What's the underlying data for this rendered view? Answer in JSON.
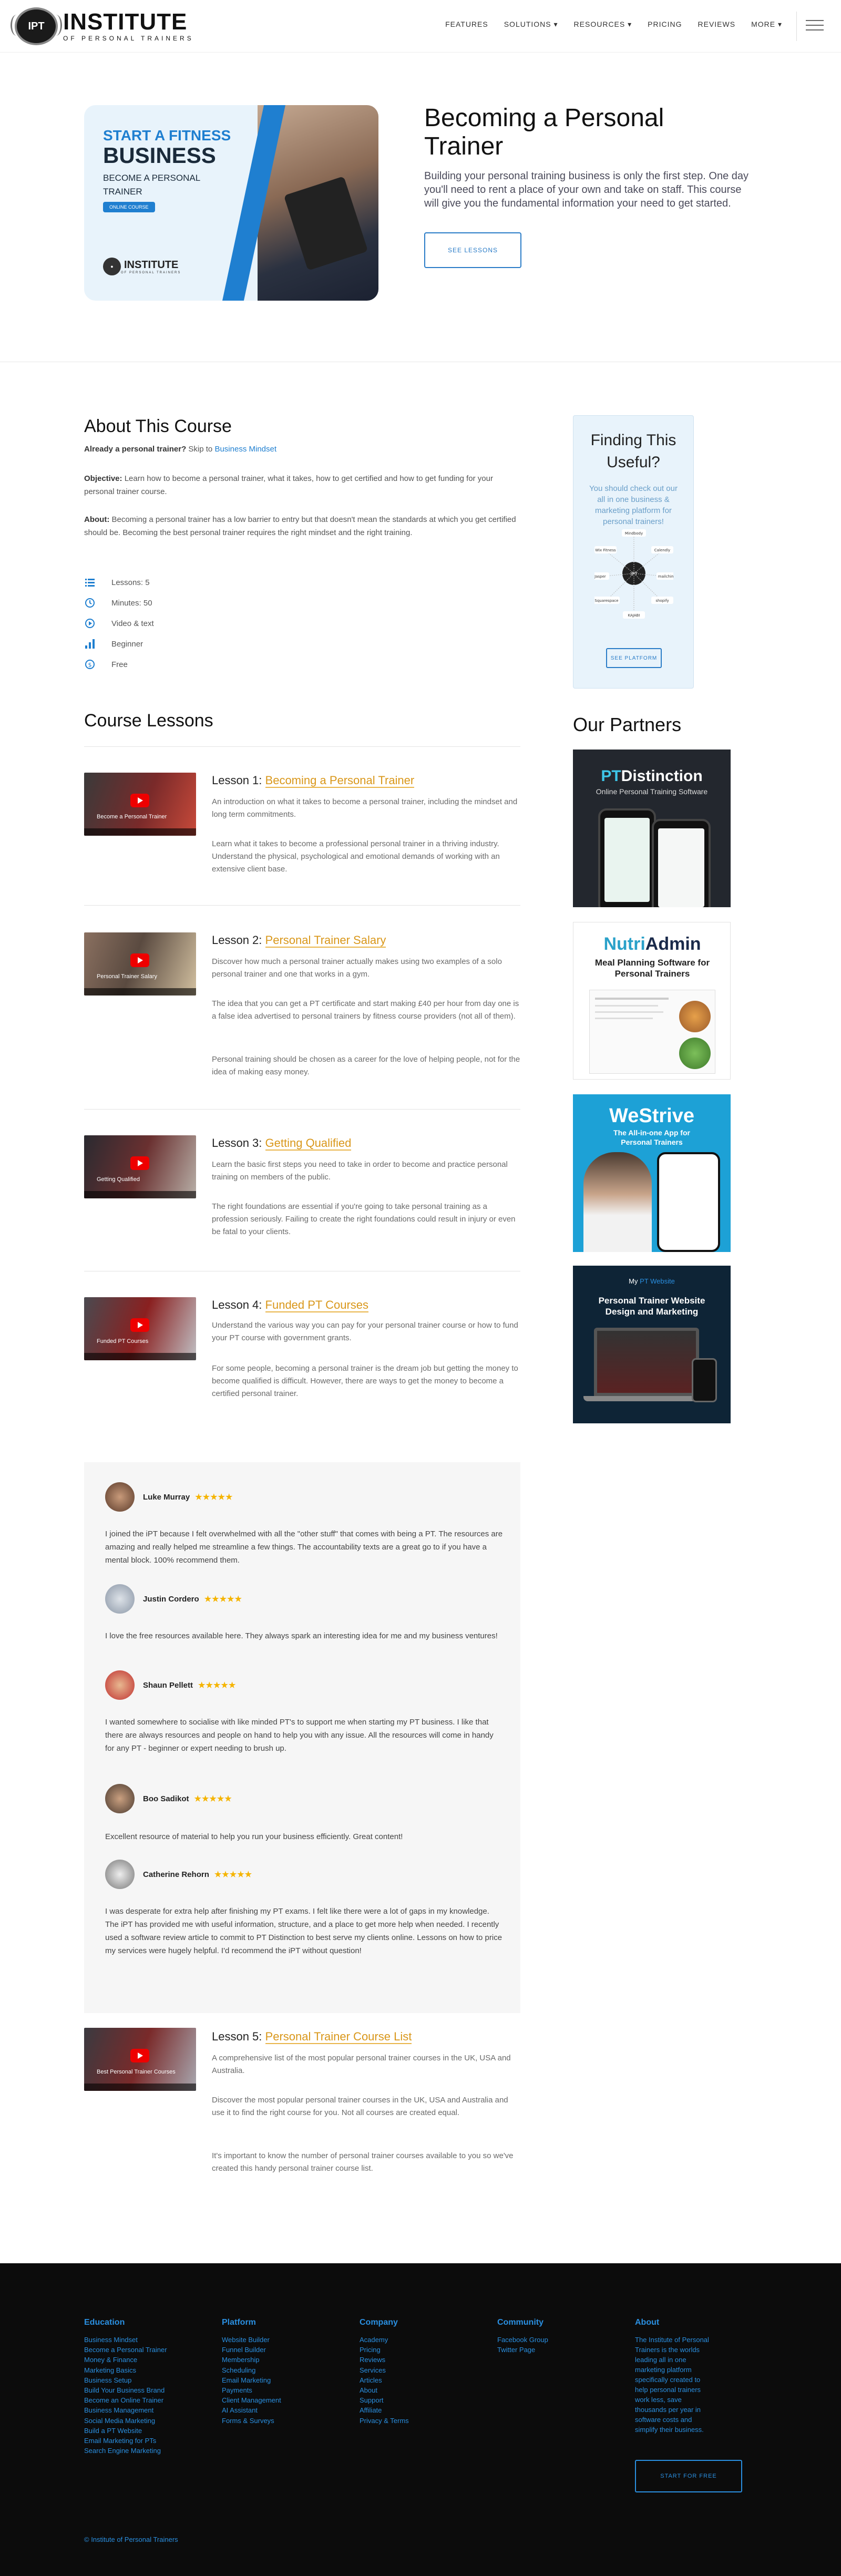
{
  "header": {
    "logo_seal": "IPT",
    "logo_main": "INSTITUTE",
    "logo_sub": "OF PERSONAL TRAINERS",
    "nav": [
      "FEATURES",
      "SOLUTIONS ▾",
      "RESOURCES ▾",
      "PRICING",
      "REVIEWS",
      "MORE ▾"
    ]
  },
  "hero": {
    "card_line1": "START A FITNESS",
    "card_line2": "BUSINESS",
    "card_line3": "BECOME A PERSONAL TRAINER",
    "card_button": "ONLINE COURSE",
    "card_logo_main": "INSTITUTE",
    "card_logo_sub": "OF PERSONAL TRAINERS",
    "title": "Becoming a Personal Trainer",
    "subtitle": "Building your personal training business is only the first step. One day you'll need to rent a place of your own and take on staff. This course will give you the fundamental information your need to get started.",
    "button": "SEE LESSONS"
  },
  "about": {
    "title": "About This Course",
    "already_label": "Already a personal trainer?",
    "skip_text": "Skip to",
    "skip_link": "Business Mindset",
    "objective_label": "Objective:",
    "objective_text": "Learn how to become a personal trainer, what it takes, how to get certified and how to get funding for your personal trainer course.",
    "about_label": "About:",
    "about_text": "Becoming a personal trainer has a low barrier to entry but that doesn't mean the standards at which you get certified should be. Becoming the best personal trainer requires the right mindset and the right training.",
    "features": [
      {
        "icon": "list-icon",
        "label": "Lessons: 5"
      },
      {
        "icon": "clock-icon",
        "label": "Minutes: 50"
      },
      {
        "icon": "play-icon",
        "label": "Video & text"
      },
      {
        "icon": "level-bars-icon",
        "label": "Beginner"
      },
      {
        "icon": "dollar-icon",
        "label": "Free"
      }
    ]
  },
  "sidebar": {
    "title": "Finding This Useful?",
    "text": "You should check out our all in one business & marketing platform for personal trainers!",
    "diagram_labels": [
      "Mindbody",
      "Wix Fitness",
      "Calendly",
      "Jasper",
      "mailchimp",
      "Squarespace",
      "shopify",
      "KAJABI"
    ],
    "button": "SEE PLATFORM",
    "partners_title": "Our Partners",
    "partners": [
      {
        "title_a": "PT",
        "title_b": "Distinction",
        "subtitle": "Online Personal Training Software"
      },
      {
        "title_a": "Nutri",
        "title_b": "Admin",
        "subtitle": "Meal Planning Software for Personal Trainers"
      },
      {
        "title_a": "We",
        "title_b": "Strive",
        "subtitle": "The All-in-one App for Personal Trainers"
      },
      {
        "title_a": "My",
        "title_b": "PT Website",
        "subtitle": "Personal Trainer Website Design and Marketing"
      }
    ]
  },
  "lessons_title": "Course Lessons",
  "lessons": [
    {
      "number": "Lesson 1:",
      "title": "Becoming a Personal Trainer",
      "thumb": "Become a Personal Trainer",
      "p1": "An introduction on what it takes to become a personal trainer, including the mindset and long term commitments.",
      "p2": "Learn what it takes to become a professional personal trainer in a thriving industry. Understand the physical, psychological and emotional demands of working with an extensive client base.",
      "p3": ""
    },
    {
      "number": "Lesson 2:",
      "title": "Personal Trainer Salary",
      "thumb": "Personal Trainer Salary",
      "p1": "Discover how much a personal trainer actually makes using two examples of a solo personal trainer and one that works in a gym.",
      "p2": "The idea that you can get a PT certificate and start making £40 per hour from day one is a false idea advertised to personal trainers by fitness course providers (not all of them).",
      "p3": "Personal training should be chosen as a career for the love of helping people, not for the idea of making easy money."
    },
    {
      "number": "Lesson 3:",
      "title": "Getting Qualified",
      "thumb": "Getting Qualified",
      "p1": "Learn the basic first steps you need to take in order to become and practice personal training on members of the public.",
      "p2": "The right foundations are essential if you're going to take personal training as a profession seriously. Failing to create the right foundations could result in injury or even be fatal to your clients.",
      "p3": ""
    },
    {
      "number": "Lesson 4:",
      "title": "Funded PT Courses",
      "thumb": "Funded PT Courses",
      "p1": "Understand the various way you can pay for your personal trainer course or how to fund your PT course with government grants.",
      "p2": "For some people, becoming a personal trainer is the dream job but getting the money to become qualified is difficult. However, there are ways to get the money to become a certified personal trainer.",
      "p3": ""
    },
    {
      "number": "Lesson 5:",
      "title": "Personal Trainer Course List",
      "thumb": "Best Personal Trainer Courses",
      "p1": "A comprehensive list of the most popular personal trainer courses in the UK, USA and Australia.",
      "p2": "Discover the most popular personal trainer courses in the UK, USA and Australia and use it to find the right course for you. Not all courses are created equal.",
      "p3": "It's important to know the number of personal trainer courses available to you so we've created this handy personal trainer course list."
    }
  ],
  "testimonials": [
    {
      "name": "Luke Murray",
      "stars": "★★★★★",
      "text": "I joined the iPT because I felt overwhelmed with all the \"other stuff\" that comes with being a PT. The resources are amazing and really helped me streamline a few things. The accountability texts are a great go to if you have a mental block. 100% recommend them."
    },
    {
      "name": "Justin Cordero",
      "stars": "★★★★★",
      "text": "I love the free resources available here. They always spark an interesting idea for me and my business ventures!"
    },
    {
      "name": "Shaun Pellett",
      "stars": "★★★★★",
      "text": "I wanted somewhere to socialise with like minded PT's to support me when starting my PT business. I like that there are always resources and people on hand to help you with any issue. All the resources will come in handy for any PT - beginner or expert needing to brush up."
    },
    {
      "name": "Boo Sadikot",
      "stars": "★★★★★",
      "text": "Excellent resource of material to help you run your business efficiently. Great content!"
    },
    {
      "name": "Catherine Rehorn",
      "stars": "★★★★★",
      "text": "I was desperate for extra help after finishing my PT exams. I felt like there were a lot of gaps in my knowledge. The iPT has provided me with useful information, structure, and a place to get more help when needed. I recently used a software review article to commit to PT Distinction to best serve my clients online. Lessons on how to price my services were hugely helpful. I'd recommend the iPT without question!"
    }
  ],
  "footer": {
    "columns": [
      {
        "title": "Education",
        "items": [
          "Business Mindset",
          "Become a Personal Trainer",
          "Money & Finance",
          "Marketing Basics",
          "Business Setup",
          "Build Your Business Brand",
          "Become an Online Trainer",
          "Business Management",
          "Social Media Marketing",
          "Build a PT Website",
          "Email Marketing for PTs",
          "Search Engine Marketing"
        ]
      },
      {
        "title": "Platform",
        "items": [
          "Website Builder",
          "Funnel Builder",
          "Membership",
          "Scheduling",
          "Email Marketing",
          "Payments",
          "Client Management",
          "AI Assistant",
          "Forms & Surveys"
        ]
      },
      {
        "title": "Company",
        "items": [
          "Academy",
          "Pricing",
          "Reviews",
          "Services",
          "Articles",
          "About",
          "Support",
          "Affiliate",
          "Privacy & Terms"
        ]
      },
      {
        "title": "Community",
        "items": [
          "Facebook Group",
          "Twitter Page"
        ]
      }
    ],
    "about_title": "About",
    "about_text": "The Institute of Personal Trainers is the worlds leading all in one marketing platform specifically created to help personal trainers work less, save thousands per year in software costs and simplify their business.",
    "button": "START FOR FREE",
    "copyright": "© Institute of Personal Trainers"
  },
  "colors": {
    "accent": "#1f7fd0",
    "lesson_link": "#d9971a",
    "footer_bg": "#0c0c0c"
  }
}
